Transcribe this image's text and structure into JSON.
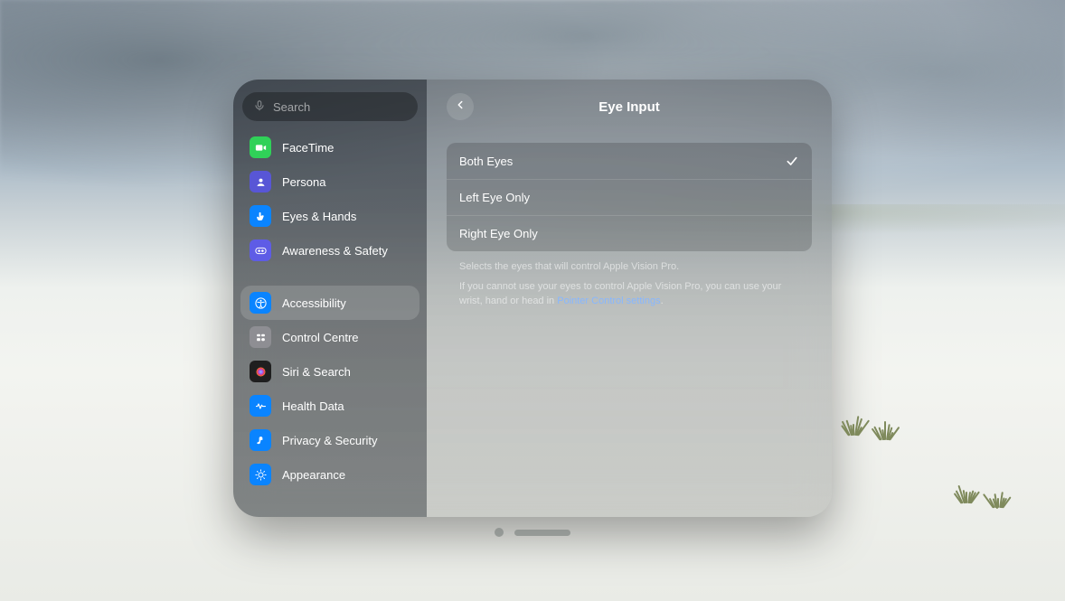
{
  "search": {
    "placeholder": "Search"
  },
  "sidebar": {
    "groups": [
      {
        "items": [
          {
            "id": "facetime",
            "label": "FaceTime",
            "color": "#30d158"
          },
          {
            "id": "persona",
            "label": "Persona",
            "color": "#5856d6"
          },
          {
            "id": "eyeshands",
            "label": "Eyes & Hands",
            "color": "#0a84ff"
          },
          {
            "id": "awareness",
            "label": "Awareness & Safety",
            "color": "#5e5ce6"
          }
        ]
      },
      {
        "items": [
          {
            "id": "accessibility",
            "label": "Accessibility",
            "color": "#0a84ff",
            "selected": true
          },
          {
            "id": "controlcentre",
            "label": "Control Centre",
            "color": "#8e8e93"
          },
          {
            "id": "siri",
            "label": "Siri & Search",
            "color": "#1f1f1f"
          },
          {
            "id": "health",
            "label": "Health Data",
            "color": "#0a84ff"
          },
          {
            "id": "privacy",
            "label": "Privacy & Security",
            "color": "#0a84ff"
          },
          {
            "id": "appearance",
            "label": "Appearance",
            "color": "#0a84ff"
          }
        ]
      }
    ]
  },
  "content": {
    "title": "Eye Input",
    "options": [
      {
        "label": "Both Eyes",
        "checked": true
      },
      {
        "label": "Left Eye Only",
        "checked": false
      },
      {
        "label": "Right Eye Only",
        "checked": false
      }
    ],
    "note1": "Selects the eyes that will control Apple Vision Pro.",
    "note2_pre": "If you cannot use your eyes to control Apple Vision Pro, you can use your wrist, hand or head in ",
    "note2_link": "Pointer Control settings",
    "note2_post": "."
  }
}
